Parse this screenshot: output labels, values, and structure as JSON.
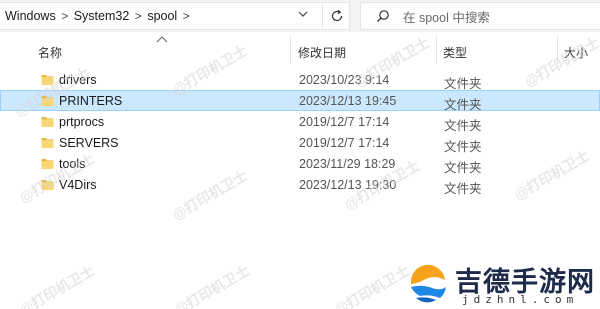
{
  "address_bar": {
    "breadcrumbs": [
      "Windows",
      "System32",
      "spool"
    ],
    "separator": ">",
    "refresh_icon": "refresh-icon",
    "dropdown_icon": "chevron-down-icon"
  },
  "search": {
    "placeholder": "在 spool 中搜索",
    "icon": "search-icon"
  },
  "columns": {
    "name": "名称",
    "modified": "修改日期",
    "type": "类型",
    "size": "大小",
    "sort_indicator": "sort-ascending-arrow"
  },
  "files": [
    {
      "name": "drivers",
      "modified": "2023/10/23 9:14",
      "type": "文件夹",
      "selected": false,
      "icon": "folder-icon"
    },
    {
      "name": "PRINTERS",
      "modified": "2023/12/13 19:45",
      "type": "文件夹",
      "selected": true,
      "icon": "folder-icon"
    },
    {
      "name": "prtprocs",
      "modified": "2019/12/7 17:14",
      "type": "文件夹",
      "selected": false,
      "icon": "folder-icon"
    },
    {
      "name": "SERVERS",
      "modified": "2019/12/7 17:14",
      "type": "文件夹",
      "selected": false,
      "icon": "folder-icon"
    },
    {
      "name": "tools",
      "modified": "2023/11/29 18:29",
      "type": "文件夹",
      "selected": false,
      "icon": "folder-icon"
    },
    {
      "name": "V4Dirs",
      "modified": "2023/12/13 19:30",
      "type": "文件夹",
      "selected": false,
      "icon": "folder-icon"
    }
  ],
  "watermark_text": "@打印机卫士",
  "brand": {
    "name": "吉德手游网",
    "url": "jdzhnl.com"
  },
  "colors": {
    "selection_bg": "#cce8ff",
    "selection_border": "#99d1ff",
    "folder_yellow": "#f8d775",
    "folder_dark": "#e8b942"
  }
}
